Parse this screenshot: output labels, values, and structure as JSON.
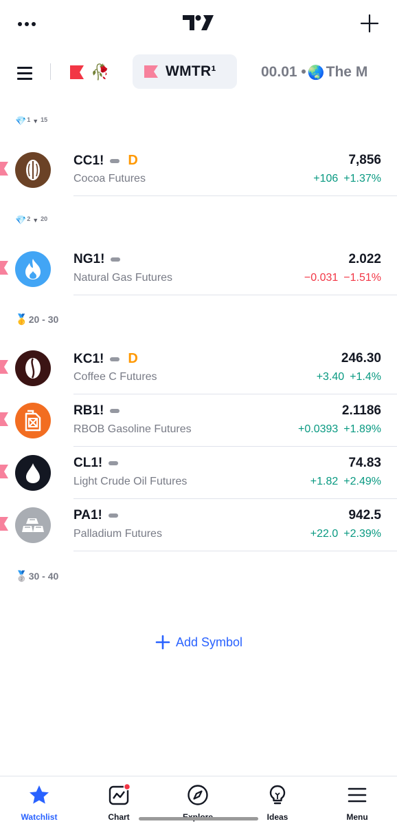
{
  "tabs": {
    "flag_emoji": "🥀",
    "active_label": "WMTR¹",
    "next_label": "00.01 • ",
    "next_globe": "🌏",
    "next_rest": "The M"
  },
  "sections": [
    {
      "icon": "💎",
      "level": "1",
      "arrow": "▼",
      "count": "15"
    },
    {
      "icon": "💎",
      "level": "2",
      "arrow": "▼",
      "count": "20"
    },
    {
      "icon": "🥇",
      "label": "20 - 30"
    },
    {
      "icon": "🥈",
      "label": "30 - 40"
    }
  ],
  "rows": [
    {
      "symbol": "CC1!",
      "flag": "D",
      "description": "Cocoa Futures",
      "price": "7,856",
      "change": "+106",
      "change_pct": "+1.37%",
      "direction": "up"
    },
    {
      "symbol": "NG1!",
      "description": "Natural Gas Futures",
      "price": "2.022",
      "change": "−0.031",
      "change_pct": "−1.51%",
      "direction": "down"
    },
    {
      "symbol": "KC1!",
      "flag": "D",
      "description": "Coffee C Futures",
      "price": "246.30",
      "change": "+3.40",
      "change_pct": "+1.4%",
      "direction": "up"
    },
    {
      "symbol": "RB1!",
      "description": "RBOB Gasoline Futures",
      "price": "2.1186",
      "change": "+0.0393",
      "change_pct": "+1.89%",
      "direction": "up"
    },
    {
      "symbol": "CL1!",
      "description": "Light Crude Oil Futures",
      "price": "74.83",
      "change": "+1.82",
      "change_pct": "+2.49%",
      "direction": "up"
    },
    {
      "symbol": "PA1!",
      "description": "Palladium Futures",
      "price": "942.5",
      "change": "+22.0",
      "change_pct": "+2.39%",
      "direction": "up"
    }
  ],
  "add_symbol_label": "Add Symbol",
  "nav": [
    {
      "label": "Watchlist",
      "active": true
    },
    {
      "label": "Chart"
    },
    {
      "label": "Explore"
    },
    {
      "label": "Ideas"
    },
    {
      "label": "Menu"
    }
  ],
  "colors": {
    "up": "#089981",
    "down": "#f23645",
    "accent": "#2962ff",
    "pin": "#f7819c",
    "flag_red": "#f23645",
    "d_flag": "#ff9800"
  }
}
